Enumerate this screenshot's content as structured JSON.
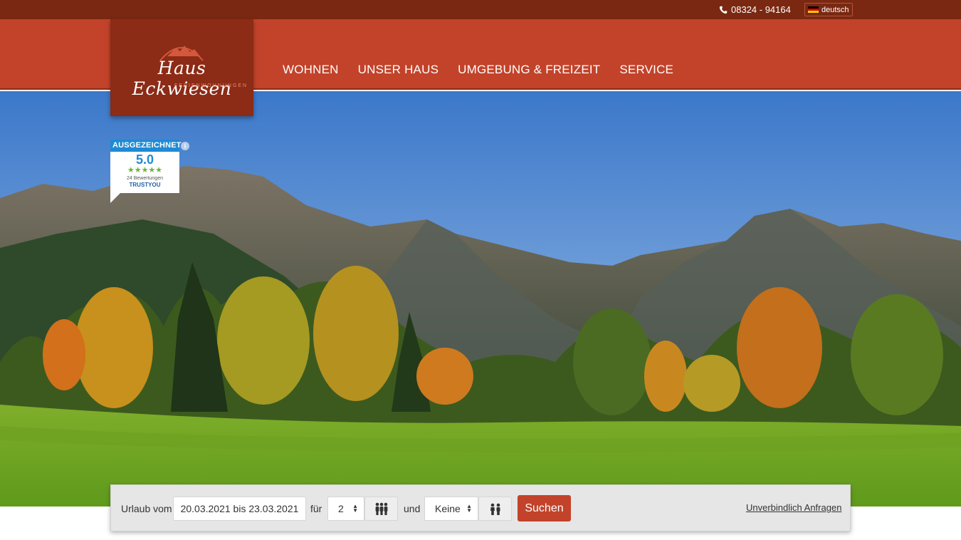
{
  "topbar": {
    "phone": "08324 - 94164",
    "phone_icon": "phone-icon",
    "language": "deutsch",
    "flag_icon": "german-flag-icon"
  },
  "logo": {
    "name": "Haus Eckwiesen",
    "subtitle": "FERIENWOHNUNGEN",
    "icon": "mountain-logo-icon"
  },
  "nav": {
    "items": [
      {
        "label": "WOHNEN"
      },
      {
        "label": "UNSER HAUS"
      },
      {
        "label": "UMGEBUNG & FREIZEIT"
      },
      {
        "label": "SERVICE"
      }
    ]
  },
  "badge": {
    "header": "AUSGEZEICHNET",
    "score": "5.0",
    "stars": "★★★★★",
    "count": "24 Bewertungen",
    "brand": "TRUSTYOU",
    "info_icon": "info-icon"
  },
  "search": {
    "label_from": "Urlaub vom",
    "date_range": "20.03.2021 bis 23.03.2021",
    "label_for": "für",
    "adults_value": "2",
    "adults_icon": "adults-icon",
    "label_and": "und",
    "children_value": "Keine",
    "children_icon": "children-icon",
    "submit_label": "Suchen",
    "inquiry_link": "Unverbindlich Anfragen"
  },
  "colors": {
    "topbar": "#7a2812",
    "navbar": "#c2432a",
    "logo_box": "#8c2b16",
    "accent_button": "#c2432a",
    "badge_blue": "#1f8ad4",
    "star_green": "#6cb33f"
  }
}
